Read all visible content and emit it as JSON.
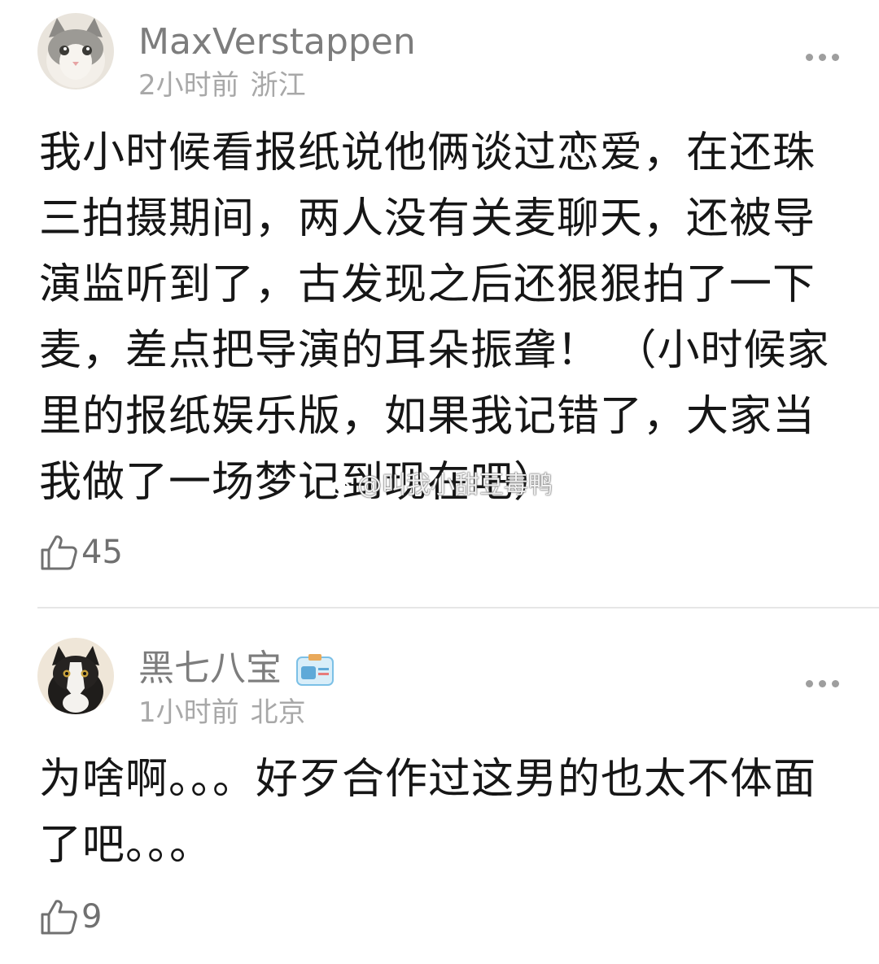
{
  "comments": [
    {
      "username": "MaxVerstappen",
      "time": "2小时前",
      "location": "浙江",
      "text": "我小时候看报纸说他俩谈过恋爱，在还珠三拍摄期间，两人没有关麦聊天，还被导演监听到了，古发现之后还狠狠拍了一下麦，差点把导演的耳朵振聋！ （小时候家里的报纸娱乐版，如果我记错了，大家当我做了一场梦记到现在吧）",
      "likes": "45",
      "avatar_icon": "cat-avatar-grey"
    },
    {
      "username": "黑七八宝",
      "time": "1小时前",
      "location": "北京",
      "text": "为啥啊。。。好歹合作过这男的也太不体面了吧。。。",
      "likes": "9",
      "avatar_icon": "cat-avatar-black-white",
      "badge_icon": "member-card-icon"
    }
  ],
  "watermark": {
    "text": "@叫我小甜豆毒鸭"
  },
  "colors": {
    "username": "#7d7d7d",
    "meta": "#a8a8a8",
    "body": "#161616",
    "like": "#707070"
  }
}
